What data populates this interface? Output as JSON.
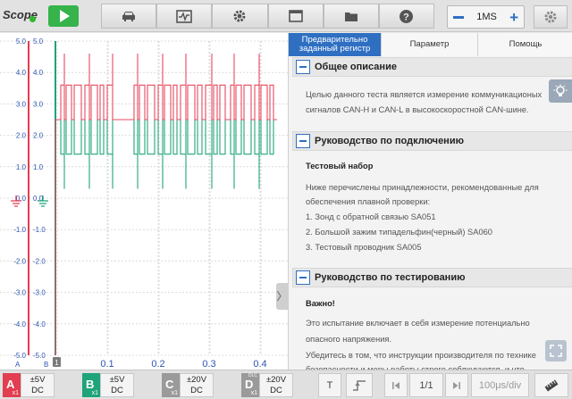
{
  "app": {
    "title": "Scope"
  },
  "toolbar": {
    "tools": [
      {
        "name": "vehicle-icon"
      },
      {
        "name": "waveform-library-icon"
      },
      {
        "name": "gear-icon"
      },
      {
        "name": "window-icon"
      },
      {
        "name": "folder-icon"
      },
      {
        "name": "help-icon"
      }
    ],
    "timebase": {
      "value": "1MS"
    },
    "settings_icon": "settings-icon"
  },
  "scope": {
    "y_ticks": [
      "5.0",
      "4.0",
      "3.0",
      "2.0",
      "1.0",
      "0.0",
      "-1.0",
      "-2.0",
      "-3.0",
      "-4.0",
      "-5.0"
    ],
    "x_ticks": [
      "0.1",
      "0.2",
      "0.3",
      "0.4"
    ],
    "corner_labels": {
      "a": "A",
      "b": "B",
      "b_num": "1"
    },
    "expand_tab": "〉"
  },
  "chart_data": {
    "type": "line",
    "title": "",
    "ylim": [
      -5,
      5
    ],
    "xlim": [
      0,
      0.45
    ],
    "series": [
      {
        "color": "#e84a5f",
        "levels_v": [
          2.5,
          3.6
        ],
        "description_levels": "CAN-H recessive 2.5, dominant ~3.6"
      },
      {
        "color": "#21a67a",
        "levels_v": [
          2.5,
          1.4
        ],
        "description_levels": "CAN-L recessive 2.5, dominant ~1.4"
      }
    ],
    "grid": true
  },
  "panel": {
    "tabs": [
      {
        "label_line1": "Предварительно",
        "label_line2": "заданный регистр",
        "active": true
      },
      {
        "label": "Параметр"
      },
      {
        "label": "Помощь"
      }
    ],
    "sections": [
      {
        "title": "Общее описание",
        "lines": [
          "Целью данного теста является измерение коммуникационых",
          "сигналов CAN-H и CAN-L в высокоскоростной CAN-шине."
        ]
      },
      {
        "title": "Руководство по подключению",
        "subtitle": "Тестовый набор",
        "lines": [
          "Ниже перечислены принадлежности, рекомендованные для",
          "обеспечения плавной проверки:",
          "1. Зонд с обратной связью SA051",
          "2. Большой зажим типадельфин(черный) SA060",
          "3. Тестовый проводник SA005"
        ]
      },
      {
        "title": "Руководство по тестированию",
        "subtitle": "Важно!",
        "lines": [
          "Это испытание включает в себя измерение потенциально",
          "опасного напряжения.",
          "Убедитесь в том, что инструкции производителя по технике",
          "безопасности и меры работы строго соблюдаются, и что"
        ]
      }
    ]
  },
  "channels": [
    {
      "letter": "A",
      "sub": "x1",
      "range": "±5V",
      "coupling": "DC",
      "color": "#e23d50"
    },
    {
      "letter": "B",
      "sub": "x1",
      "range": "±5V",
      "coupling": "DC",
      "color": "#1fa37a"
    },
    {
      "letter": "C",
      "sub": "x1",
      "range": "±20V",
      "coupling": "DC",
      "color": "#9a9a9a"
    },
    {
      "letter": "D",
      "sub": "x1",
      "top": "DLC",
      "range": "±20V",
      "coupling": "DC",
      "color": "#9a9a9a"
    }
  ],
  "bottom": {
    "trigger_label": "T",
    "page": "1/1",
    "timebase": "100μs/div"
  }
}
